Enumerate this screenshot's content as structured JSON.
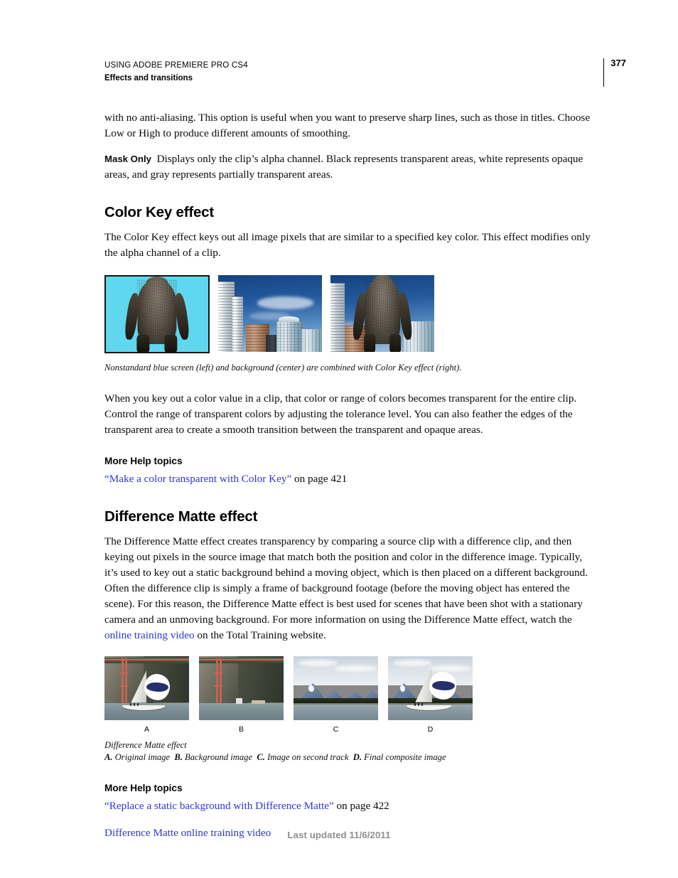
{
  "header": {
    "running_title": "USING ADOBE PREMIERE PRO CS4",
    "running_subtitle": "Effects and transitions",
    "page_number": "377"
  },
  "body": {
    "continued_paragraph": "with no anti-aliasing. This option is useful when you want to preserve sharp lines, such as those in titles. Choose Low or High to produce different amounts of smoothing.",
    "mask_only_runin": "Mask Only",
    "mask_only_text": "Displays only the clip’s alpha channel. Black represents transparent areas, white represents opaque areas, and gray represents partially transparent areas."
  },
  "color_key": {
    "heading": "Color Key effect",
    "intro": "The Color Key effect keys out all image pixels that are similar to a specified key color. This effect modifies only the alpha channel of a clip.",
    "figure_caption": "Nonstandard blue screen (left) and background (center) are combined with Color Key effect (right).",
    "figures": [
      {
        "alt": "Gorilla in front of a cyan blue screen"
      },
      {
        "alt": "City skyscrapers against a blue sky"
      },
      {
        "alt": "Gorilla composited over the city skyline"
      }
    ],
    "body": "When you key out a color value in a clip, that color or range of colors becomes transparent for the entire clip. Control the range of transparent colors by adjusting the tolerance level. You can also feather the edges of the transparent area to create a smooth transition between the transparent and opaque areas.",
    "more_help_heading": "More Help topics",
    "xref_open_quote": "“",
    "xref_link": "Make a color transparent with Color Key",
    "xref_close_quote": "”",
    "xref_tail": " on page 421"
  },
  "difference_matte": {
    "heading": "Difference Matte effect",
    "body_before_link": "The Difference Matte effect creates transparency by comparing a source clip with a difference clip, and then keying out pixels in the source image that match both the position and color in the difference image. Typically, it’s used to key out a static background behind a moving object, which is then placed on a different background. Often the difference clip is simply a frame of background footage (before the moving object has entered the scene). For this reason, the Difference Matte effect is best used for scenes that have been shot with a stationary camera and an unmoving background. For more information on using the Difference Matte effect, watch the ",
    "body_link": "online training video",
    "body_after_link": " on the Total Training website.",
    "figures": [
      {
        "label": "A",
        "alt": "Sailboat in front of a bridge and cliff"
      },
      {
        "label": "B",
        "alt": "Bridge and cliff background without the sailboat"
      },
      {
        "label": "C",
        "alt": "Mountain lake scene on the second track"
      },
      {
        "label": "D",
        "alt": "Sailboat composited over the mountain lake"
      }
    ],
    "figure_caption_title": "Difference Matte effect",
    "figure_caption_keys": [
      {
        "key": "A.",
        "text": " Original image"
      },
      {
        "key": "B.",
        "text": " Background image"
      },
      {
        "key": "C.",
        "text": " Image on second track"
      },
      {
        "key": "D.",
        "text": " Final composite image"
      }
    ],
    "more_help_heading": "More Help topics",
    "xref_open_quote": "“",
    "xref_link": "Replace a static background with Difference Matte",
    "xref_close_quote": "”",
    "xref_tail": " on page 422",
    "video_link": "Difference Matte online training video"
  },
  "footer": {
    "last_updated": "Last updated 11/6/2011"
  },
  "colors": {
    "link": "#2e35d6",
    "text": "#0a0a0a",
    "footer_text": "#8f8f8f",
    "blue_screen": "#5fd8ef",
    "spinnaker_navy": "#26306b"
  }
}
